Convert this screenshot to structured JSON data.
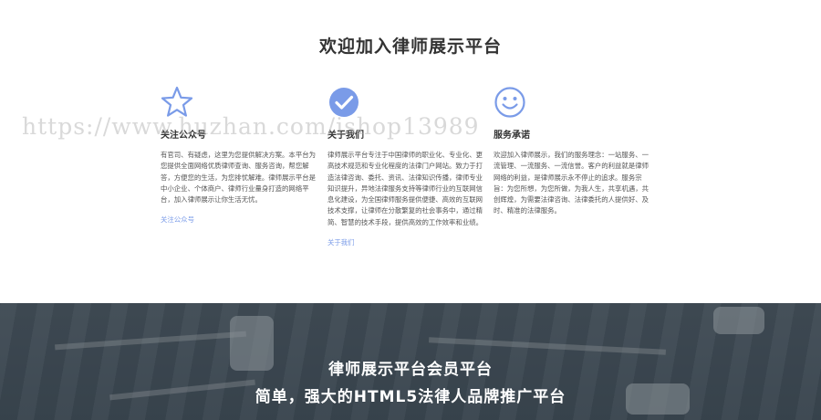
{
  "section": {
    "title": "欢迎加入律师展示平台"
  },
  "columns": [
    {
      "icon": "star-outline-icon",
      "title": "关注公众号",
      "text": "有官司、有疑虑，这里为您提供解决方案。本平台为您提供全面网络优质律师查询、服务咨询，帮您解答，方便您的生活，为您排忧解难。律师展示平台是中小企业、个体商户、律师行业量身打造的网络平台，加入律师展示让你生活无忧。",
      "link": "关注公众号"
    },
    {
      "icon": "check-circle-icon",
      "title": "关于我们",
      "text": "律师展示平台专注于中国律师的职业化、专业化、更高技术规范和专业化程度的法律门户网站。致力于打造法律咨询、委托、资讯、法律知识传播，律师专业知识提升，异地法律服务支持等律师行业的互联网信息化建设，为全国律师服务提供便捷、高效的互联网技术支撑，让律师在分散繁复的社会事务中，通过精简、智慧的技术手段，提供高效的工作效率和业绩。",
      "link": "关于我们"
    },
    {
      "icon": "smile-face-icon",
      "title": "服务承诺",
      "text": "欢迎加入律师展示，我们的服务理念：一站服务、一流管理、一流服务、一流信誉。客户的利益就是律师网络的利益，是律师展示永不停止的追求。服务宗旨：为您所想，为您所做，为我人生，共享机遇，共创辉煌，为需要法律咨询、法律委托的人提供好、及时、精准的法律服务。",
      "link": ""
    }
  ],
  "watermark": "https://www.huzhan.com/ishop13989",
  "banner": {
    "title": "律师展示平台会员平台",
    "subtitle": "简单，强大的HTML5法律人品牌推广平台"
  },
  "colors": {
    "accent": "#7a9be8",
    "banner_bg": "#45515b",
    "text": "#333333"
  }
}
